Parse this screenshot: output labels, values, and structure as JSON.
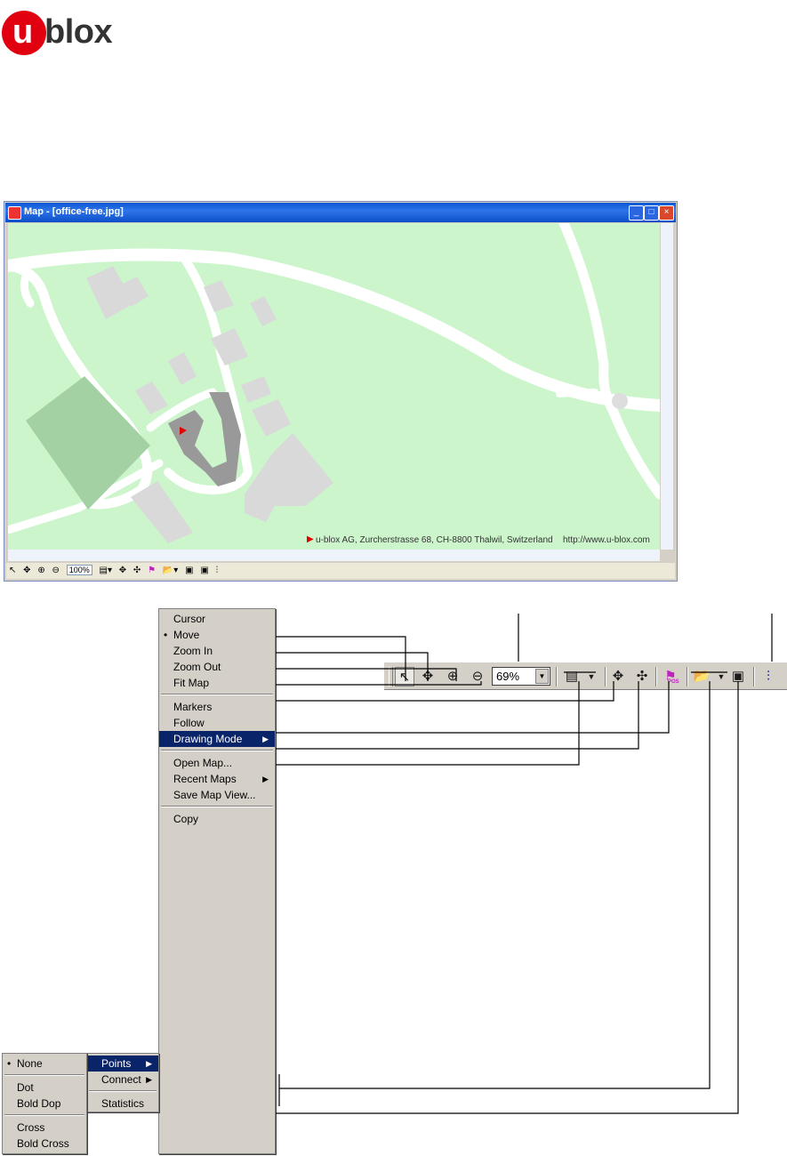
{
  "logo": {
    "first": "u",
    "rest": "blox"
  },
  "window": {
    "title": "Map - [office-free.jpg]",
    "buttons": {
      "minimize": "_",
      "maximize": "□",
      "close": "×"
    },
    "footer_marker": "▶",
    "footer_address": "u-blox AG, Zurcherstrasse 68, CH-8800 Thalwil, Switzerland",
    "footer_url": "http://www.u-blox.com",
    "toolbar_zoom": "100%"
  },
  "big_toolbar": {
    "zoom_value": "69%",
    "pos_label": "POS"
  },
  "context_menu": {
    "items": [
      {
        "label": "Cursor"
      },
      {
        "label": "Move",
        "bullet": "•"
      },
      {
        "label": "Zoom In"
      },
      {
        "label": "Zoom Out"
      },
      {
        "label": "Fit Map"
      },
      {
        "label": "Markers"
      },
      {
        "label": "Follow"
      },
      {
        "label": "Drawing Mode"
      },
      {
        "label": "Open Map..."
      },
      {
        "label": "Recent Maps"
      },
      {
        "label": "Save Map View..."
      },
      {
        "label": "Copy"
      }
    ]
  },
  "drawing_submenu": {
    "items": [
      {
        "label": "Points"
      },
      {
        "label": "Connect"
      },
      {
        "label": "Statistics"
      }
    ]
  },
  "points_submenu": {
    "items": [
      {
        "label": "None",
        "bullet": "•"
      },
      {
        "label": "Dot"
      },
      {
        "label": "Bold Dop"
      },
      {
        "label": "Cross"
      },
      {
        "label": "Bold Cross"
      }
    ]
  },
  "colors": {
    "logo_red": "#e10010",
    "map_green": "#ccf5cc",
    "menu_highlight": "#0a246a"
  }
}
